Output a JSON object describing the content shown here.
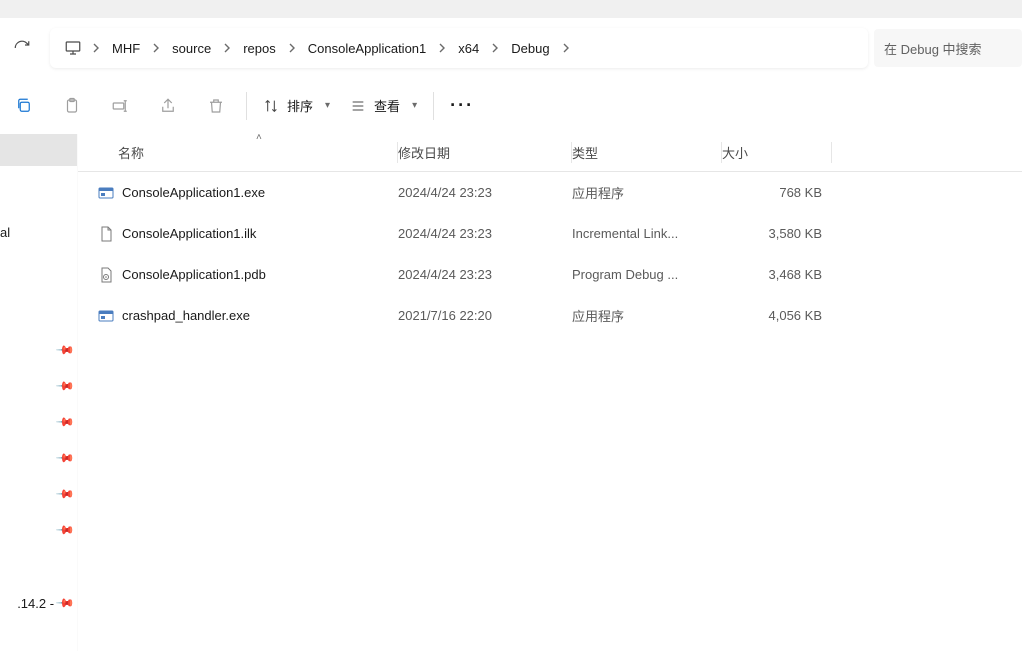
{
  "breadcrumb": {
    "items": [
      "MHF",
      "source",
      "repos",
      "ConsoleApplication1",
      "x64",
      "Debug"
    ]
  },
  "search": {
    "placeholder": "在 Debug 中搜索"
  },
  "commands": {
    "sort": "排序",
    "view": "查看"
  },
  "columns": {
    "name": "名称",
    "date": "修改日期",
    "type": "类型",
    "size": "大小"
  },
  "files": [
    {
      "icon": "exe",
      "name": "ConsoleApplication1.exe",
      "date": "2024/4/24 23:23",
      "type": "应用程序",
      "size": "768 KB"
    },
    {
      "icon": "ilk",
      "name": "ConsoleApplication1.ilk",
      "date": "2024/4/24 23:23",
      "type": "Incremental Link...",
      "size": "3,580 KB"
    },
    {
      "icon": "pdb",
      "name": "ConsoleApplication1.pdb",
      "date": "2024/4/24 23:23",
      "type": "Program Debug ...",
      "size": "3,468 KB"
    },
    {
      "icon": "exe",
      "name": "crashpad_handler.exe",
      "date": "2021/7/16 22:20",
      "type": "应用程序",
      "size": "4,056 KB"
    }
  ],
  "sidebar": {
    "partial_item": "al",
    "version_item": ".14.2 -"
  }
}
